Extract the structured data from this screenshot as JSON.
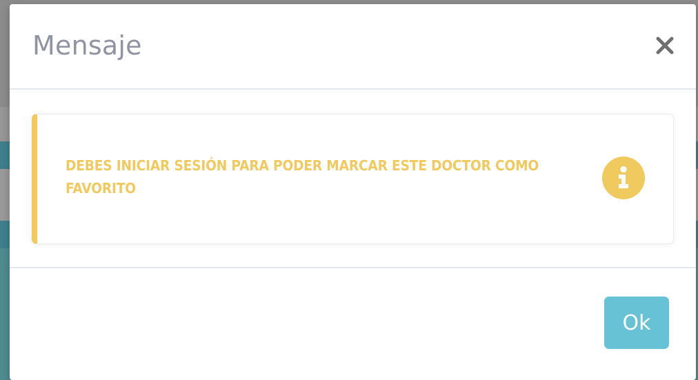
{
  "modal": {
    "title": "Mensaje",
    "close_icon": "close-icon",
    "alert": {
      "message": "DEBES INICIAR SESIÓN PARA PODER MARCAR ESTE DOCTOR COMO FAVORITO",
      "icon": "info-icon",
      "accent_color": "#f0c95f"
    },
    "ok_label": "Ok",
    "ok_color": "#67c2d5"
  }
}
